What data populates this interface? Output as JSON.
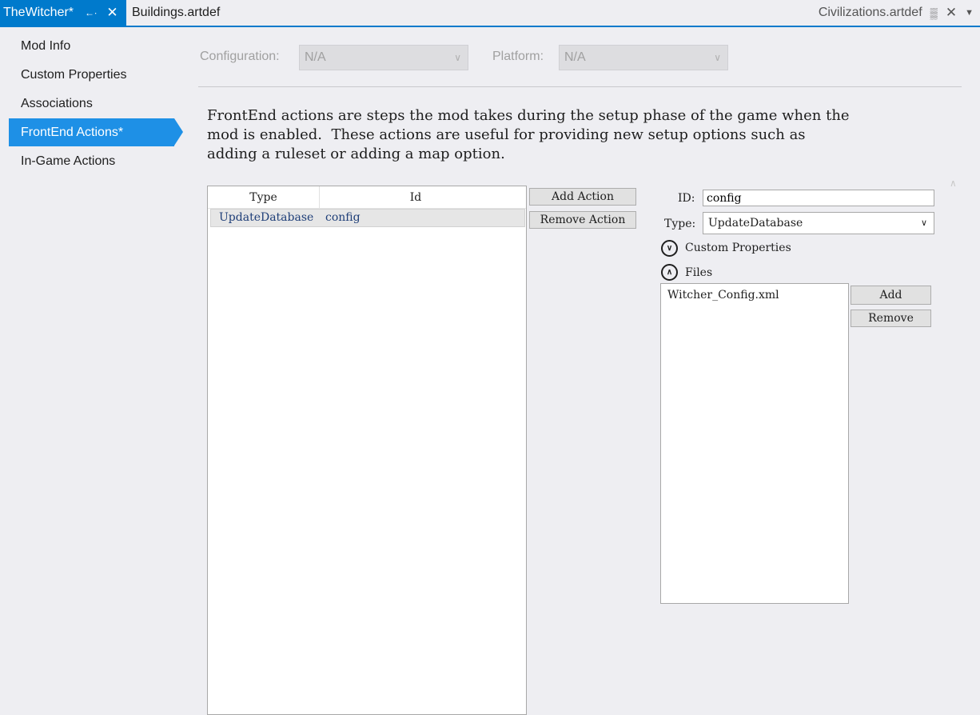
{
  "tabs": {
    "active": {
      "label": "TheWitcher*",
      "pin_icon": "pin-icon",
      "close_icon": "close-icon"
    },
    "second": {
      "label": "Buildings.artdef"
    },
    "right": {
      "label": "Civilizations.artdef",
      "pin_icon": "pin-icon",
      "close_icon": "close-icon",
      "dropdown_icon": "dropdown-icon"
    }
  },
  "sidebar": {
    "items": [
      {
        "label": "Mod Info"
      },
      {
        "label": "Custom Properties"
      },
      {
        "label": "Associations"
      },
      {
        "label": "FrontEnd Actions*"
      },
      {
        "label": "In-Game Actions"
      }
    ],
    "active_index": 3,
    "accent_color": "#1e90e6"
  },
  "config": {
    "configuration_label": "Configuration:",
    "configuration_value": "N/A",
    "platform_label": "Platform:",
    "platform_value": "N/A"
  },
  "description": "FrontEnd actions are steps the mod takes during the setup phase of the game when the\nmod is enabled.  These actions are useful for providing new setup options such as\nadding a ruleset or adding a map option.",
  "actions_table": {
    "columns": [
      "Type",
      "Id"
    ],
    "rows": [
      {
        "type": "UpdateDatabase",
        "id": "config"
      }
    ]
  },
  "buttons": {
    "add_action": "Add Action",
    "remove_action": "Remove Action",
    "add_file": "Add",
    "remove_file": "Remove"
  },
  "detail": {
    "id_label": "ID:",
    "id_value": "config",
    "type_label": "Type:",
    "type_value": "UpdateDatabase",
    "custom_properties_label": "Custom Properties",
    "files_label": "Files",
    "files": [
      "Witcher_Config.xml"
    ]
  },
  "colors": {
    "accent": "#007acc",
    "background": "#eeeef2"
  }
}
